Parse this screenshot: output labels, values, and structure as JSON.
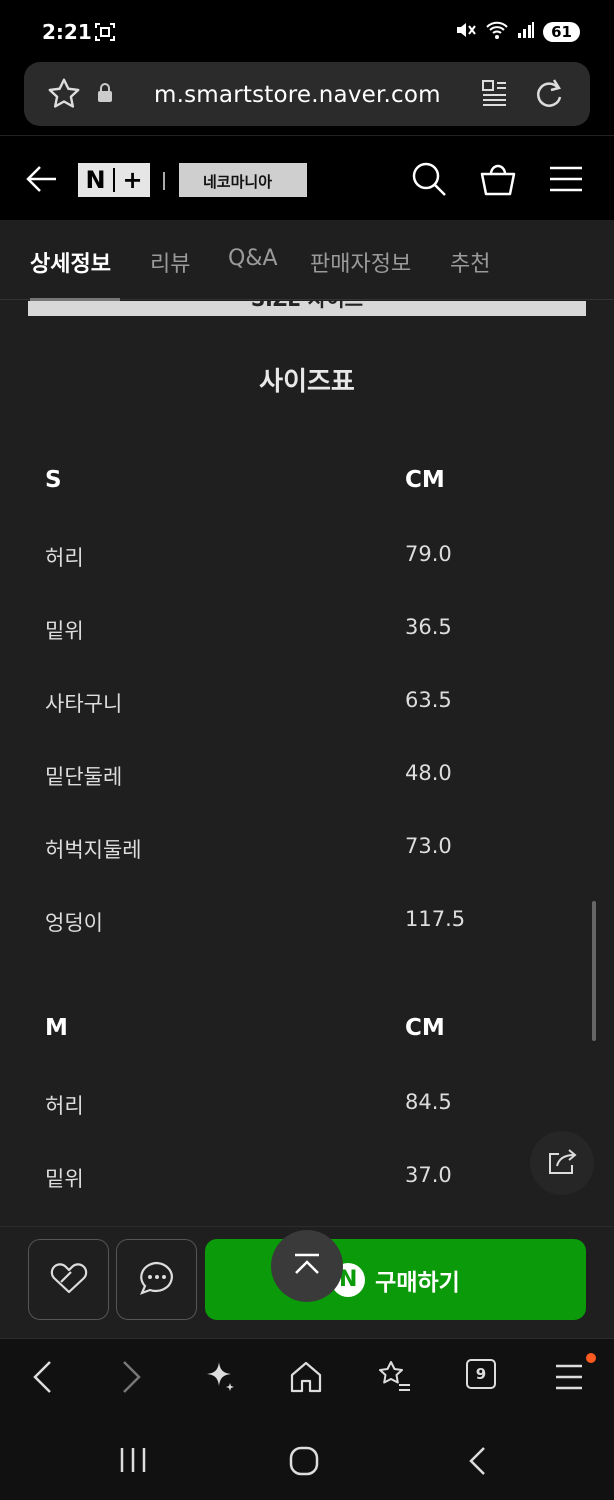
{
  "status": {
    "time": "2:21",
    "battery": "61"
  },
  "browser": {
    "url": "m.smartstore.naver.com"
  },
  "store": {
    "nplus_left": "N",
    "nplus_right": "+",
    "shop_name": "네코마니아"
  },
  "tabs": [
    {
      "label": "상세정보"
    },
    {
      "label": "리뷰"
    },
    {
      "label": "Q&A"
    },
    {
      "label": "판매자정보"
    },
    {
      "label": "추천"
    }
  ],
  "content": {
    "banner_text": "SIZE 사이즈",
    "size_table_title": "사이즈표",
    "sections": [
      {
        "size": "S",
        "unit": "CM",
        "rows": [
          {
            "name": "허리",
            "value": "79.0"
          },
          {
            "name": "밑위",
            "value": "36.5"
          },
          {
            "name": "사타구니",
            "value": "63.5"
          },
          {
            "name": "밑단둘레",
            "value": "48.0"
          },
          {
            "name": "허벅지둘레",
            "value": "73.0"
          },
          {
            "name": "엉덩이",
            "value": "117.5"
          }
        ]
      },
      {
        "size": "M",
        "unit": "CM",
        "rows": [
          {
            "name": "허리",
            "value": "84.5"
          },
          {
            "name": "밑위",
            "value": "37.0"
          }
        ]
      }
    ]
  },
  "buy_bar": {
    "buy_label": "구매하기",
    "buy_badge": "N"
  },
  "browser_nav": {
    "tab_count": "9"
  },
  "colors": {
    "buy_green": "#0a9a0a",
    "background": "#1f1f1f",
    "notification": "#ff5a1f"
  }
}
